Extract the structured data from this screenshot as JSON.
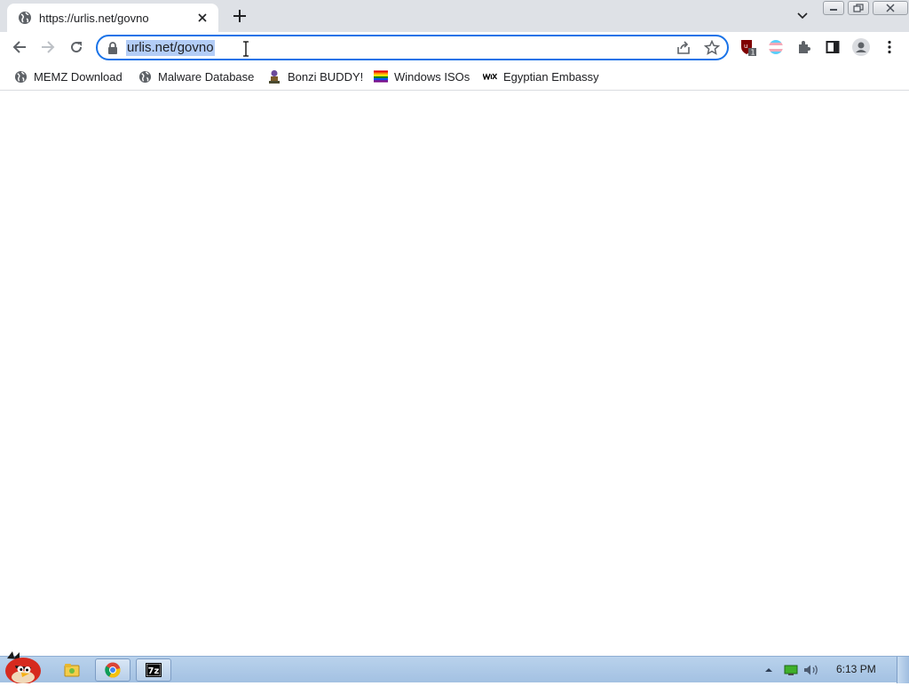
{
  "tab": {
    "title": "https://urlis.net/govno",
    "favicon": "globe-icon"
  },
  "window": {
    "controls": [
      "minimize",
      "restore",
      "close"
    ]
  },
  "omnibox": {
    "url": "urlis.net/govno"
  },
  "extensions": [
    "ublock-icon",
    "trans-flag-icon",
    "puzzle-icon",
    "side-panel-icon",
    "profile-icon",
    "kebab-menu-icon"
  ],
  "extension_badge": "1",
  "bookmarks": [
    {
      "label": "MEMZ Download",
      "icon": "globe-icon"
    },
    {
      "label": "Malware Database",
      "icon": "globe-icon"
    },
    {
      "label": "Bonzi BUDDY!",
      "icon": "bonzi-icon"
    },
    {
      "label": "Windows ISOs",
      "icon": "rainbow-flag-icon"
    },
    {
      "label": "Egyptian Embassy",
      "icon": "wix-icon"
    }
  ],
  "taskbar": {
    "icons": [
      "angry-bird-start-icon",
      "explorer-icon",
      "chrome-icon",
      "7zip-icon"
    ],
    "tray": [
      "show-hidden-icons",
      "network-icon",
      "volume-icon"
    ],
    "clock": "6:13 PM"
  },
  "colors": {
    "tabstrip": "#dee1e6",
    "accent": "#1a73e8",
    "selection": "#b3cdf7",
    "taskbar": "#b9d2ec"
  }
}
